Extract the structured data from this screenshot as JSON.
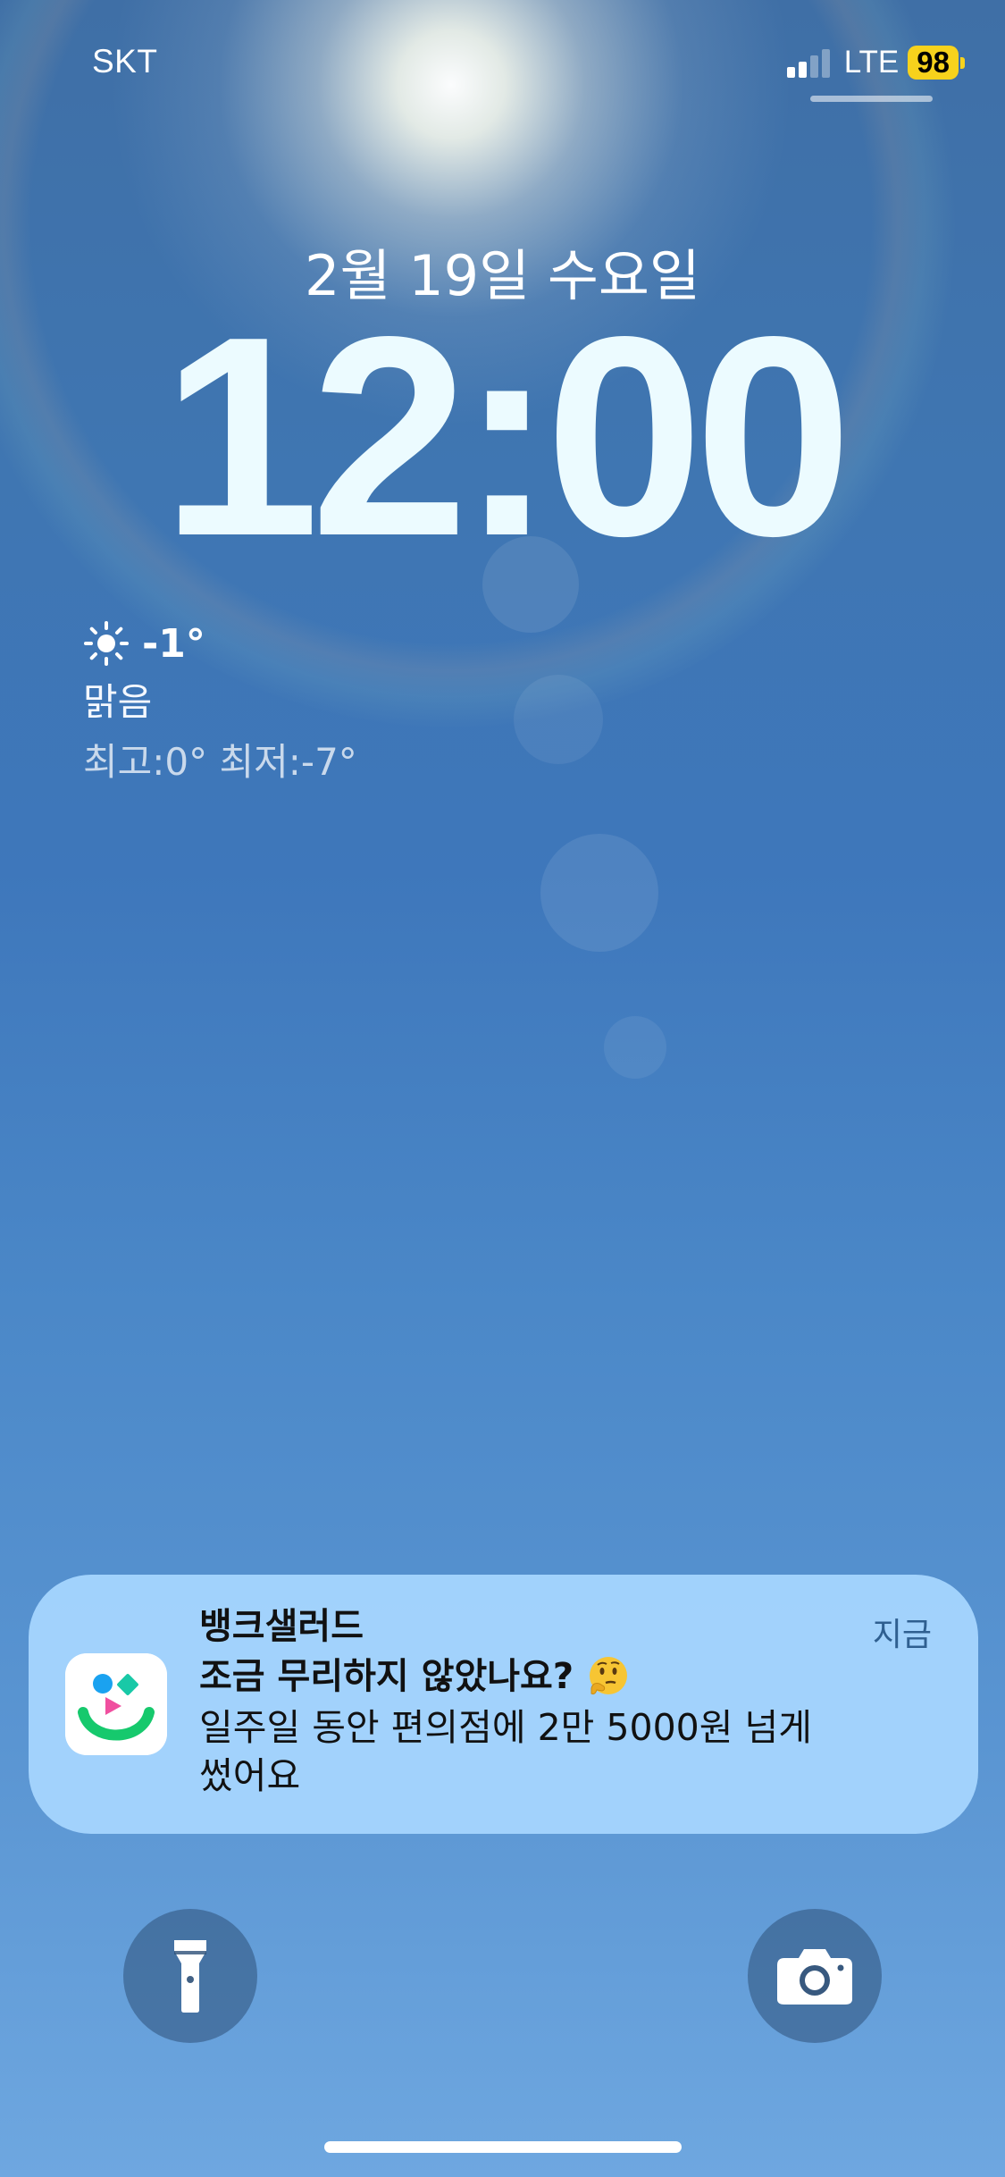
{
  "status_bar": {
    "carrier": "SKT",
    "network": "LTE",
    "battery_level": "98",
    "signal_bars_active": 2,
    "signal_bars_total": 4,
    "battery_color": "#f7d21c"
  },
  "lock_screen": {
    "date": "2월 19일 수요일",
    "time": "12:00"
  },
  "weather": {
    "icon": "sun-icon",
    "temperature": "-1°",
    "condition": "맑음",
    "high_low": "최고:0° 최저:-7°"
  },
  "notification": {
    "app_name": "뱅크샐러드",
    "title": "조금 무리하지 않았나요?",
    "title_icon": "thinking-face-icon",
    "body": "일주일 동안 편의점에 2만 5000원 넘게 썼어요",
    "time": "지금",
    "background_color": "#a4d4fd",
    "app_icon_colors": [
      "#1aa2f0",
      "#19c9a7",
      "#f04f9f",
      "#16c96d"
    ]
  },
  "quick_actions": {
    "left": "flashlight-icon",
    "right": "camera-icon"
  }
}
